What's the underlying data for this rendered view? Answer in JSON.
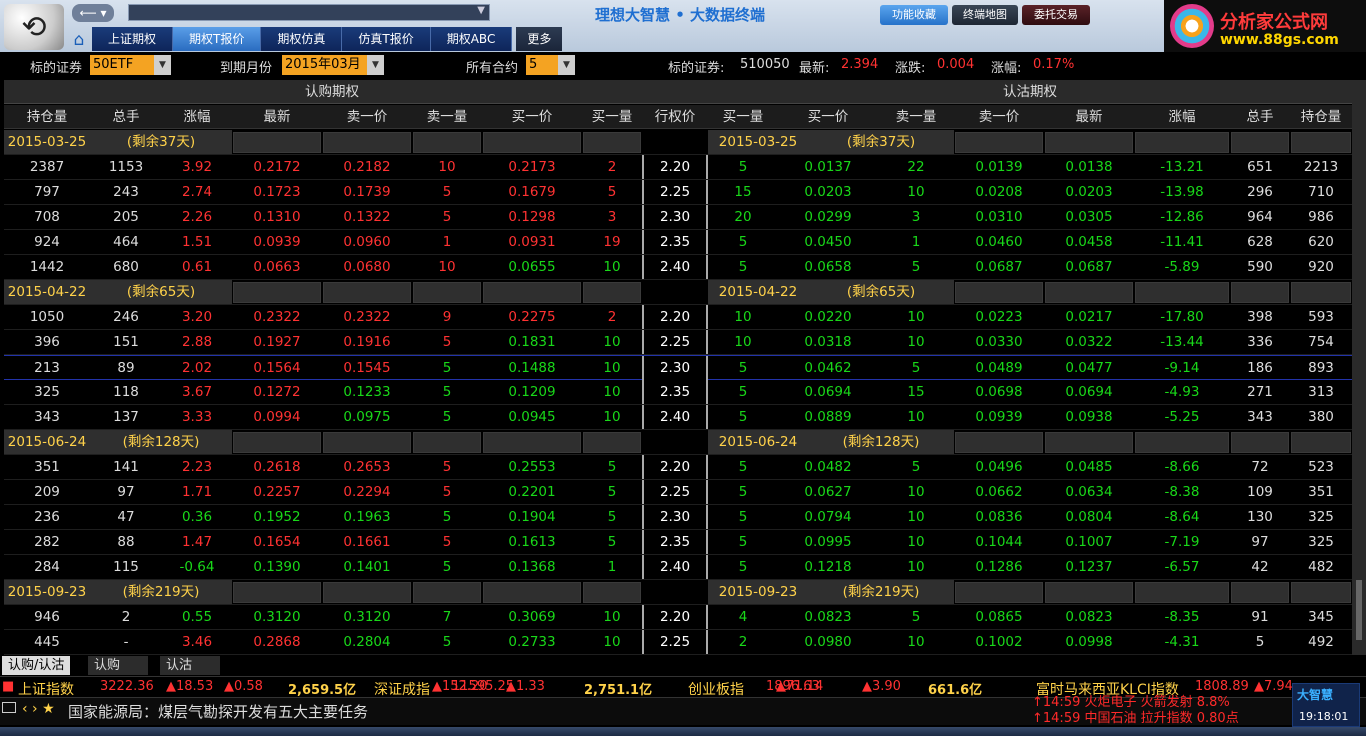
{
  "app": {
    "title": "理想大智慧 • 大数据终端",
    "back_forward": "⟵ ▾",
    "buttons": [
      "功能收藏",
      "终端地图",
      "委托交易"
    ],
    "tabs": [
      "上证期权",
      "期权T报价",
      "期权仿真",
      "仿真T报价",
      "期权ABC"
    ],
    "active_tab": "期权T报价",
    "more": "更多",
    "brand_title": "分析家公式网",
    "brand_url": "www.88gs.com"
  },
  "filter": {
    "underlying_label": "标的证券",
    "underlying_value": "50ETF",
    "month_label": "到期月份",
    "month_value": "2015年03月",
    "contract_label": "所有合约",
    "contract_value": "5",
    "code_label": "标的证券:",
    "code_value": "510050",
    "last_label": "最新:",
    "last_value": "2.394",
    "chg_label": "涨跌:",
    "chg_value": "0.004",
    "pct_label": "涨幅:",
    "pct_value": "0.17%"
  },
  "grid": {
    "call_title": "认购期权",
    "put_title": "认沽期权",
    "call_headers": [
      "持仓量",
      "总手",
      "涨幅",
      "最新",
      "卖一价",
      "卖一量",
      "买一价",
      "买一量"
    ],
    "strike_header": "行权价",
    "put_headers": [
      "买一量",
      "买一价",
      "卖一量",
      "卖一价",
      "最新",
      "涨幅",
      "总手",
      "持仓量"
    ],
    "groups": [
      {
        "date": "2015-03-25",
        "remain": "(剩余37天)",
        "rows": [
          {
            "call": [
              "2387",
              "1153",
              "3.92",
              "0.2172",
              "0.2182",
              "10",
              "0.2173",
              "2"
            ],
            "cc": [
              "w",
              "w",
              "u",
              "u",
              "u",
              "u",
              "u",
              "u"
            ],
            "strike": "2.20",
            "put": [
              "5",
              "0.0137",
              "22",
              "0.0139",
              "0.0138",
              "-13.21",
              "651",
              "2213"
            ],
            "pc": [
              "d",
              "d",
              "d",
              "d",
              "d",
              "d",
              "w",
              "w"
            ]
          },
          {
            "call": [
              "797",
              "243",
              "2.74",
              "0.1723",
              "0.1739",
              "5",
              "0.1679",
              "5"
            ],
            "cc": [
              "w",
              "w",
              "u",
              "u",
              "u",
              "u",
              "u",
              "u"
            ],
            "strike": "2.25",
            "put": [
              "15",
              "0.0203",
              "10",
              "0.0208",
              "0.0203",
              "-13.98",
              "296",
              "710"
            ],
            "pc": [
              "d",
              "d",
              "d",
              "d",
              "d",
              "d",
              "w",
              "w"
            ]
          },
          {
            "call": [
              "708",
              "205",
              "2.26",
              "0.1310",
              "0.1322",
              "5",
              "0.1298",
              "3"
            ],
            "cc": [
              "w",
              "w",
              "u",
              "u",
              "u",
              "u",
              "u",
              "u"
            ],
            "strike": "2.30",
            "put": [
              "20",
              "0.0299",
              "3",
              "0.0310",
              "0.0305",
              "-12.86",
              "964",
              "986"
            ],
            "pc": [
              "d",
              "d",
              "d",
              "d",
              "d",
              "d",
              "w",
              "w"
            ]
          },
          {
            "call": [
              "924",
              "464",
              "1.51",
              "0.0939",
              "0.0960",
              "1",
              "0.0931",
              "19"
            ],
            "cc": [
              "w",
              "w",
              "u",
              "u",
              "u",
              "u",
              "u",
              "u"
            ],
            "strike": "2.35",
            "put": [
              "5",
              "0.0450",
              "1",
              "0.0460",
              "0.0458",
              "-11.41",
              "628",
              "620"
            ],
            "pc": [
              "d",
              "d",
              "d",
              "d",
              "d",
              "d",
              "w",
              "w"
            ]
          },
          {
            "call": [
              "1442",
              "680",
              "0.61",
              "0.0663",
              "0.0680",
              "10",
              "0.0655",
              "10"
            ],
            "cc": [
              "w",
              "w",
              "u",
              "u",
              "u",
              "u",
              "d",
              "d"
            ],
            "strike": "2.40",
            "put": [
              "5",
              "0.0658",
              "5",
              "0.0687",
              "0.0687",
              "-5.89",
              "590",
              "920"
            ],
            "pc": [
              "d",
              "d",
              "d",
              "d",
              "d",
              "d",
              "w",
              "w"
            ]
          }
        ]
      },
      {
        "date": "2015-04-22",
        "remain": "(剩余65天)",
        "rows": [
          {
            "call": [
              "1050",
              "246",
              "3.20",
              "0.2322",
              "0.2322",
              "9",
              "0.2275",
              "2"
            ],
            "cc": [
              "w",
              "w",
              "u",
              "u",
              "u",
              "u",
              "u",
              "u"
            ],
            "strike": "2.20",
            "put": [
              "10",
              "0.0220",
              "10",
              "0.0223",
              "0.0217",
              "-17.80",
              "398",
              "593"
            ],
            "pc": [
              "d",
              "d",
              "d",
              "d",
              "d",
              "d",
              "w",
              "w"
            ]
          },
          {
            "call": [
              "396",
              "151",
              "2.88",
              "0.1927",
              "0.1916",
              "5",
              "0.1831",
              "10"
            ],
            "cc": [
              "w",
              "w",
              "u",
              "u",
              "u",
              "u",
              "d",
              "d"
            ],
            "strike": "2.25",
            "put": [
              "10",
              "0.0318",
              "10",
              "0.0330",
              "0.0322",
              "-13.44",
              "336",
              "754"
            ],
            "pc": [
              "d",
              "d",
              "d",
              "d",
              "d",
              "d",
              "w",
              "w"
            ]
          },
          {
            "call": [
              "213",
              "89",
              "2.02",
              "0.1564",
              "0.1545",
              "5",
              "0.1488",
              "10"
            ],
            "cc": [
              "w",
              "w",
              "u",
              "u",
              "u",
              "d",
              "d",
              "d"
            ],
            "strike": "2.30",
            "put": [
              "5",
              "0.0462",
              "5",
              "0.0489",
              "0.0477",
              "-9.14",
              "186",
              "893"
            ],
            "pc": [
              "d",
              "d",
              "d",
              "d",
              "d",
              "d",
              "w",
              "w"
            ],
            "hl": true
          },
          {
            "call": [
              "325",
              "118",
              "3.67",
              "0.1272",
              "0.1233",
              "5",
              "0.1209",
              "10"
            ],
            "cc": [
              "w",
              "w",
              "u",
              "u",
              "d",
              "d",
              "d",
              "d"
            ],
            "strike": "2.35",
            "put": [
              "5",
              "0.0694",
              "15",
              "0.0698",
              "0.0694",
              "-4.93",
              "271",
              "313"
            ],
            "pc": [
              "d",
              "d",
              "d",
              "d",
              "d",
              "d",
              "w",
              "w"
            ]
          },
          {
            "call": [
              "343",
              "137",
              "3.33",
              "0.0994",
              "0.0975",
              "5",
              "0.0945",
              "10"
            ],
            "cc": [
              "w",
              "w",
              "u",
              "u",
              "d",
              "d",
              "d",
              "d"
            ],
            "strike": "2.40",
            "put": [
              "5",
              "0.0889",
              "10",
              "0.0939",
              "0.0938",
              "-5.25",
              "343",
              "380"
            ],
            "pc": [
              "d",
              "d",
              "d",
              "d",
              "d",
              "d",
              "w",
              "w"
            ]
          }
        ]
      },
      {
        "date": "2015-06-24",
        "remain": "(剩余128天)",
        "rows": [
          {
            "call": [
              "351",
              "141",
              "2.23",
              "0.2618",
              "0.2653",
              "5",
              "0.2553",
              "5"
            ],
            "cc": [
              "w",
              "w",
              "u",
              "u",
              "u",
              "u",
              "d",
              "d"
            ],
            "strike": "2.20",
            "put": [
              "5",
              "0.0482",
              "5",
              "0.0496",
              "0.0485",
              "-8.66",
              "72",
              "523"
            ],
            "pc": [
              "d",
              "d",
              "d",
              "d",
              "d",
              "d",
              "w",
              "w"
            ]
          },
          {
            "call": [
              "209",
              "97",
              "1.71",
              "0.2257",
              "0.2294",
              "5",
              "0.2201",
              "5"
            ],
            "cc": [
              "w",
              "w",
              "u",
              "u",
              "u",
              "u",
              "d",
              "d"
            ],
            "strike": "2.25",
            "put": [
              "5",
              "0.0627",
              "10",
              "0.0662",
              "0.0634",
              "-8.38",
              "109",
              "351"
            ],
            "pc": [
              "d",
              "d",
              "d",
              "d",
              "d",
              "d",
              "w",
              "w"
            ]
          },
          {
            "call": [
              "236",
              "47",
              "0.36",
              "0.1952",
              "0.1963",
              "5",
              "0.1904",
              "5"
            ],
            "cc": [
              "w",
              "w",
              "d",
              "d",
              "d",
              "d",
              "d",
              "d"
            ],
            "strike": "2.30",
            "put": [
              "5",
              "0.0794",
              "10",
              "0.0836",
              "0.0804",
              "-8.64",
              "130",
              "325"
            ],
            "pc": [
              "d",
              "d",
              "d",
              "d",
              "d",
              "d",
              "w",
              "w"
            ]
          },
          {
            "call": [
              "282",
              "88",
              "1.47",
              "0.1654",
              "0.1661",
              "5",
              "0.1613",
              "5"
            ],
            "cc": [
              "w",
              "w",
              "u",
              "u",
              "u",
              "u",
              "d",
              "d"
            ],
            "strike": "2.35",
            "put": [
              "5",
              "0.0995",
              "10",
              "0.1044",
              "0.1007",
              "-7.19",
              "97",
              "325"
            ],
            "pc": [
              "d",
              "d",
              "d",
              "d",
              "d",
              "d",
              "w",
              "w"
            ]
          },
          {
            "call": [
              "284",
              "115",
              "-0.64",
              "0.1390",
              "0.1401",
              "5",
              "0.1368",
              "1"
            ],
            "cc": [
              "w",
              "w",
              "d",
              "d",
              "d",
              "d",
              "d",
              "d"
            ],
            "strike": "2.40",
            "put": [
              "5",
              "0.1218",
              "10",
              "0.1286",
              "0.1237",
              "-6.57",
              "42",
              "482"
            ],
            "pc": [
              "d",
              "d",
              "d",
              "d",
              "d",
              "d",
              "w",
              "w"
            ]
          }
        ]
      },
      {
        "date": "2015-09-23",
        "remain": "(剩余219天)",
        "rows": [
          {
            "call": [
              "946",
              "2",
              "0.55",
              "0.3120",
              "0.3120",
              "7",
              "0.3069",
              "10"
            ],
            "cc": [
              "w",
              "w",
              "d",
              "d",
              "d",
              "d",
              "d",
              "d"
            ],
            "strike": "2.20",
            "put": [
              "4",
              "0.0823",
              "5",
              "0.0865",
              "0.0823",
              "-8.35",
              "91",
              "345"
            ],
            "pc": [
              "d",
              "d",
              "d",
              "d",
              "d",
              "d",
              "w",
              "w"
            ]
          },
          {
            "call": [
              "445",
              "-",
              "3.46",
              "0.2868",
              "0.2804",
              "5",
              "0.2733",
              "10"
            ],
            "cc": [
              "w",
              "w",
              "u",
              "u",
              "d",
              "d",
              "d",
              "d"
            ],
            "strike": "2.25",
            "put": [
              "2",
              "0.0980",
              "10",
              "0.1002",
              "0.0998",
              "-4.31",
              "5",
              "492"
            ],
            "pc": [
              "d",
              "d",
              "d",
              "d",
              "d",
              "d",
              "w",
              "w"
            ]
          }
        ]
      }
    ]
  },
  "bottom_tabs": [
    "认购/认沽",
    "认购",
    "认沽"
  ],
  "ticker": [
    {
      "name": "上证指数",
      "value": "3222.36",
      "chg": "▲18.53",
      "pct": "▲0.58",
      "amount": "2,659.5亿"
    },
    {
      "name": "深证成指",
      "value": "11595.25",
      "chg": "▲152.20",
      "pct": "▲1.33",
      "amount": "2,751.1亿"
    },
    {
      "name": "创业板指",
      "value": "1896.63",
      "chg": "▲71.14",
      "pct": "▲3.90",
      "amount": "661.6亿"
    },
    {
      "name": "富时马来西亚KLCI指数",
      "value": "1808.89",
      "chg": "▲7.94"
    }
  ],
  "news": {
    "headline": "国家能源局：煤层气勘探开发有五大主要任务",
    "nav": "‹ › ★"
  },
  "alerts": [
    "↑14:59 火炬电子 火箭发射 8.8%",
    "↑14:59 中国石油 拉升指数 0.80点"
  ],
  "clock": {
    "brand": "大智慧",
    "time": "19:18:01"
  },
  "colors": {
    "up": "#ff3232",
    "down": "#19d819",
    "accent": "#f4a322"
  }
}
